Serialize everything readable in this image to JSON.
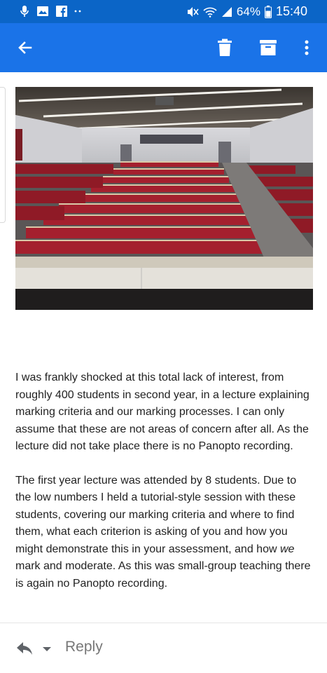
{
  "status_bar": {
    "battery_percent": "64%",
    "time": "15:40",
    "icons": [
      "microphone-icon",
      "image-icon",
      "facebook-icon",
      "more-dots-icon",
      "mute-icon",
      "wifi-icon",
      "signal-icon",
      "battery-icon"
    ]
  },
  "app_bar": {
    "icons": [
      "back-arrow-icon",
      "trash-icon",
      "archive-icon",
      "overflow-menu-icon"
    ]
  },
  "image": {
    "description_icon": "lecture-hall-photo"
  },
  "message": {
    "paragraph1": "I was frankly shocked at this total lack of interest, from roughly 400 students in second year, in a lecture explaining marking criteria and our marking processes. I can only assume that these are not areas of concern after all. As the lecture did not take place there is no Panopto recording.",
    "p2_before": "The first year lecture was attended by 8 students. Due to the low numbers I held a tutorial-style session with these students, covering our marking criteria and where to find them, what each criterion is asking of you and how you might demonstrate this in your assessment, and how ",
    "p2_em": "we",
    "p2_after": " mark and moderate. As this was small-group teaching there is again no Panopto recording."
  },
  "footer": {
    "reply_label": "Reply"
  },
  "colors": {
    "status_bar": "#0b65c7",
    "app_bar": "#1a73e8",
    "seat_red": "#a4202e"
  }
}
